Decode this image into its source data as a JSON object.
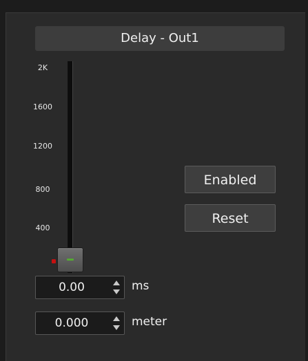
{
  "panel": {
    "title": "Delay - Out1"
  },
  "slider": {
    "scale_labels": [
      "2K",
      "1600",
      "1200",
      "800",
      "400"
    ],
    "value_fraction": 0
  },
  "delay_ms": {
    "value": "0.00",
    "unit": "ms"
  },
  "delay_meter": {
    "value": "0.000",
    "unit": "meter"
  },
  "buttons": {
    "enabled_label": "Enabled",
    "reset_label": "Reset"
  },
  "colors": {
    "background": "#1c1c1c",
    "panel": "#2a2a2a",
    "zero_marker": "#c51010",
    "thumb_grip": "#55aa33"
  },
  "icons": [
    "spin-up-arrow-icon",
    "spin-down-arrow-icon"
  ]
}
